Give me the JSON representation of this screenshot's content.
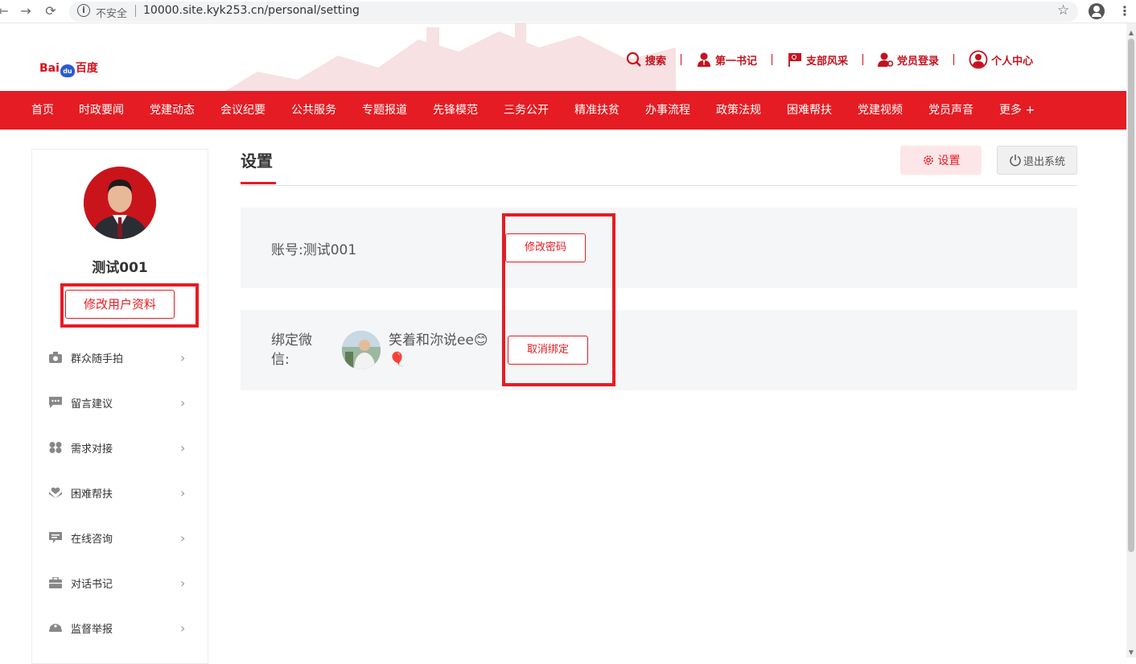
{
  "browser": {
    "back": "←",
    "forward": "→",
    "reload": "⟳",
    "info": "i",
    "insecure_label": "不安全",
    "url": "10000.site.kyk253.cn/personal/setting",
    "star": "☆",
    "menu": "⋮"
  },
  "header": {
    "logo_left": "Bai",
    "logo_paw": "du",
    "logo_right": "百度",
    "links": [
      {
        "label": "搜索",
        "icon": "search-icon"
      },
      {
        "label": "第一书记",
        "icon": "secretary-icon"
      },
      {
        "label": "支部风采",
        "icon": "party-flag-icon"
      },
      {
        "label": "党员登录",
        "icon": "member-login-icon"
      },
      {
        "label": "个人中心",
        "icon": "user-circle-icon"
      }
    ]
  },
  "nav": {
    "items": [
      "首页",
      "时政要闻",
      "党建动态",
      "会议纪要",
      "公共服务",
      "专题报道",
      "先锋模范",
      "三务公开",
      "精准扶贫",
      "办事流程",
      "政策法规",
      "困难帮扶",
      "党建视频",
      "党员声音",
      "更多 +"
    ]
  },
  "sidebar": {
    "user_name": "测试001",
    "edit_profile": "修改用户资料",
    "chevron": "›",
    "menu": [
      {
        "label": "群众随手拍",
        "icon": "camera-icon"
      },
      {
        "label": "留言建议",
        "icon": "message-icon"
      },
      {
        "label": "需求对接",
        "icon": "grid-icon"
      },
      {
        "label": "困难帮扶",
        "icon": "help-hands-icon"
      },
      {
        "label": "在线咨询",
        "icon": "chat-icon"
      },
      {
        "label": "对话书记",
        "icon": "briefcase-icon"
      },
      {
        "label": "监督举报",
        "icon": "police-cap-icon"
      }
    ]
  },
  "content": {
    "title": "设置",
    "settings_btn": "设置",
    "logout_btn": "退出系统",
    "account_label": "账号:",
    "account_value": "测试001",
    "change_password": "修改密码",
    "wechat_label": "绑定微信:",
    "wechat_nick": "笑着和沵说ee😊🎈",
    "unbind": "取消绑定"
  },
  "colors": {
    "brand_red": "#e51c23",
    "link_red": "#c3121f"
  }
}
